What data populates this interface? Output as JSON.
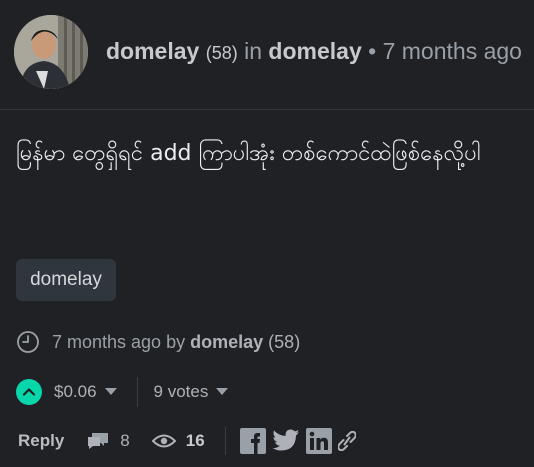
{
  "header": {
    "author": "domelay",
    "reputation": "(58)",
    "in_word": "in",
    "community": "domelay",
    "bullet": "•",
    "time_ago": "7 months ago"
  },
  "post": {
    "body": "မြန်မာ တွေရှိရင် add ကြာပါအုံး တစ်ကောင်ထဲဖြစ်နေလို့ပါ"
  },
  "tags": [
    "domelay"
  ],
  "meta": {
    "time_ago": "7 months ago",
    "by_word": "by",
    "author": "domelay",
    "reputation": "(58)"
  },
  "votes": {
    "payout": "$0.06",
    "votes_label": "9 votes"
  },
  "footer": {
    "reply_label": "Reply",
    "comments_count": "8",
    "views_count": "16"
  },
  "colors": {
    "background": "#1f2125",
    "upvote_accent": "#06d6a9",
    "tag_background": "#2f363e"
  },
  "icons": [
    "clock-icon",
    "upvote-chevron-icon",
    "comments-icon",
    "eye-icon",
    "facebook-icon",
    "twitter-icon",
    "linkedin-icon",
    "link-icon"
  ]
}
